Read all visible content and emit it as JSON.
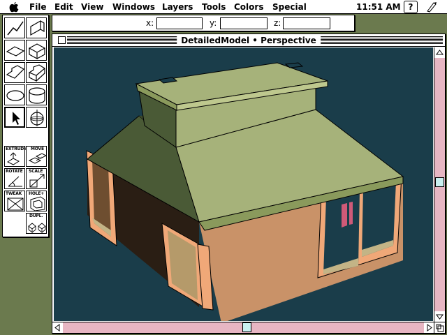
{
  "menubar": {
    "apple_icon": "apple-icon",
    "items": [
      {
        "label": "File"
      },
      {
        "label": "Edit"
      },
      {
        "label": "View"
      },
      {
        "label": "Windows"
      },
      {
        "label": "Layers"
      },
      {
        "label": "Tools"
      },
      {
        "label": "Colors"
      },
      {
        "label": "Special"
      }
    ],
    "clock": "11:51 AM",
    "help_label": "?",
    "app_icon": "modeling-app-icon"
  },
  "coordinates": {
    "x_label": "x:",
    "y_label": "y:",
    "z_label": "z:",
    "x_value": "",
    "y_value": "",
    "z_value": ""
  },
  "tool_palette": {
    "tools": [
      {
        "name": "line-tool",
        "icon": "polyline-icon",
        "label": ""
      },
      {
        "name": "plane-tool",
        "icon": "vertical-plane-icon",
        "label": ""
      },
      {
        "name": "rectangle-tool",
        "icon": "rectangle-icon",
        "label": ""
      },
      {
        "name": "box-tool",
        "icon": "box-icon",
        "label": ""
      },
      {
        "name": "polygon-tool",
        "icon": "polygon-icon",
        "label": ""
      },
      {
        "name": "polygon-solid-tool",
        "icon": "polygon-solid-icon",
        "label": ""
      },
      {
        "name": "oval-tool",
        "icon": "oval-icon",
        "label": ""
      },
      {
        "name": "cylinder-tool",
        "icon": "cylinder-icon",
        "label": ""
      },
      {
        "name": "select-tool",
        "icon": "arrow-pointer-icon",
        "label": ""
      },
      {
        "name": "view-sphere-tool",
        "icon": "sphere-axis-icon",
        "label": ""
      },
      {
        "name": "extrude-tool",
        "icon": "extrude-icon",
        "label": "EXTRUDE"
      },
      {
        "name": "move-tool",
        "icon": "move-icon",
        "label": "MOVE"
      },
      {
        "name": "rotate-tool",
        "icon": "rotate-icon",
        "label": "ROTATE"
      },
      {
        "name": "scale-tool",
        "icon": "scale-icon",
        "label": "SCALE"
      },
      {
        "name": "tweak-tool",
        "icon": "tweak-icon",
        "label": "TWEAK"
      },
      {
        "name": "hole-tool",
        "icon": "hole-icon",
        "label": "HOLE+"
      },
      {
        "name": "duplicate-tool",
        "icon": "duplicate-icon",
        "label": "DUPL."
      }
    ]
  },
  "window": {
    "title": "DetailedModel • Perspective",
    "background_color": "#1a3d4a",
    "scrollbar_color": "#f2c8d2",
    "vertical_scroll_position": 0.49,
    "horizontal_scroll_position": 0.51
  },
  "model": {
    "roof_color": "#a6b27a",
    "roof_shadow_color": "#4a5a36",
    "wall_color": "#c99268",
    "trim_color": "#f0a878",
    "glass_color": "#c3b486"
  }
}
